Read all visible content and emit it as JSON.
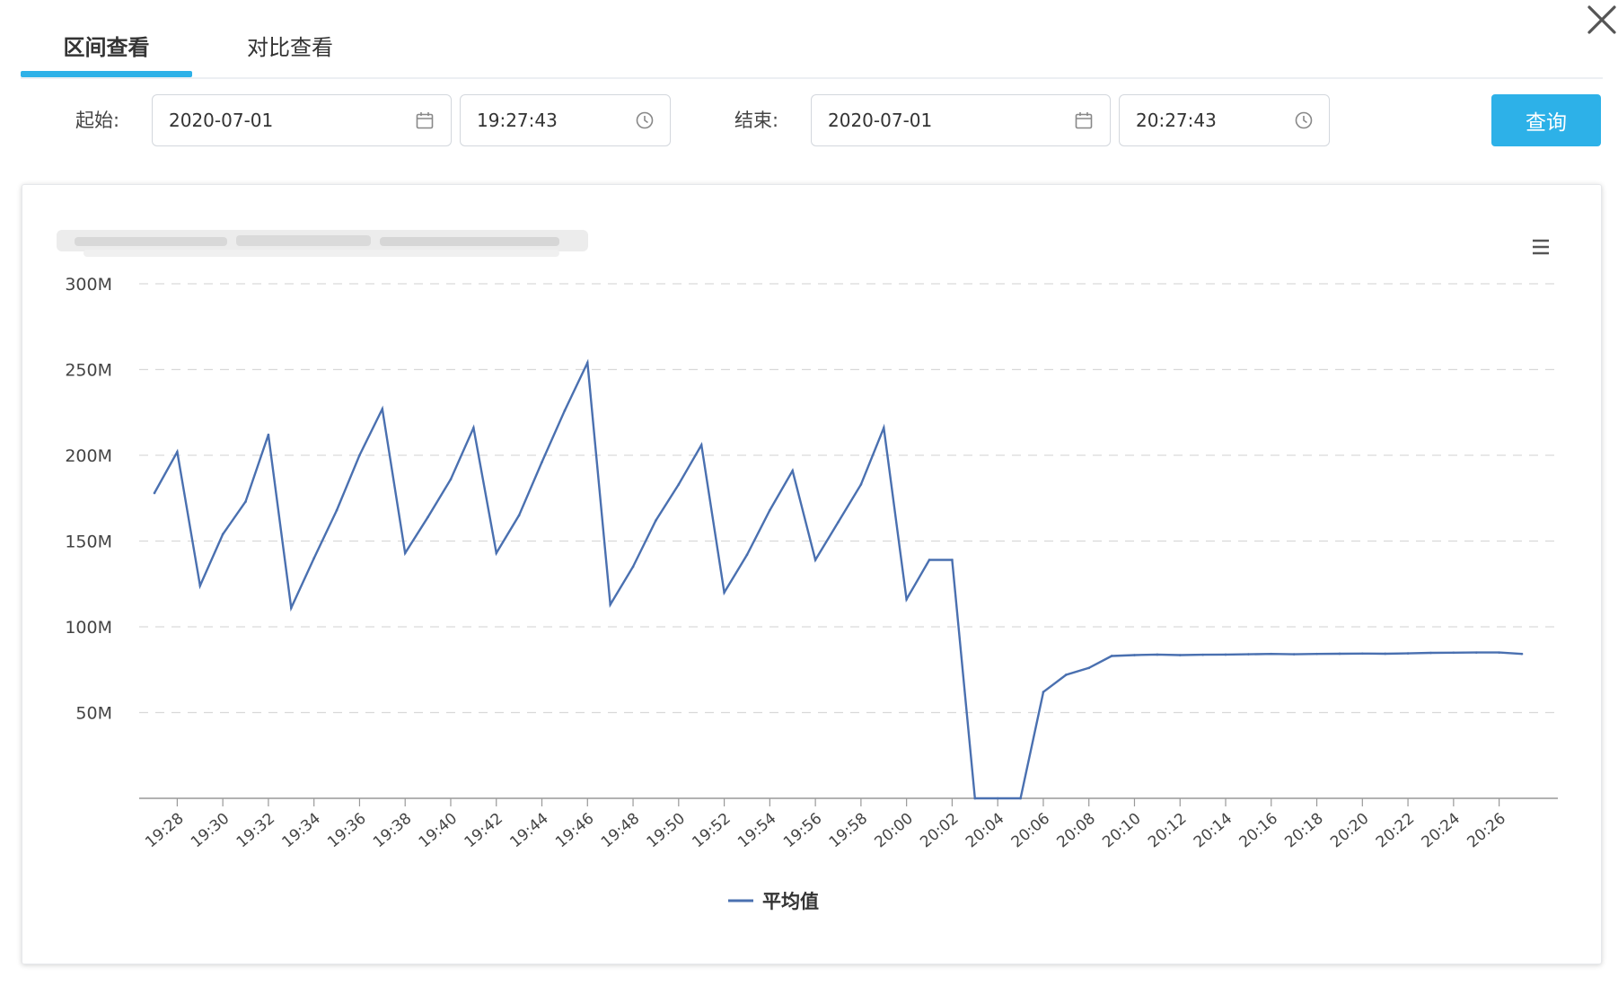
{
  "tabs": [
    {
      "label": "区间查看",
      "active": true
    },
    {
      "label": "对比查看",
      "active": false
    }
  ],
  "filter": {
    "start_label": "起始:",
    "start_date": "2020-07-01",
    "start_time": "19:27:43",
    "end_label": "结束:",
    "end_date": "2020-07-01",
    "end_time": "20:27:43",
    "query_label": "查询"
  },
  "icons": {
    "close": "close-icon",
    "date": "calendar-icon",
    "time": "clock-icon",
    "menu": "hamburger-menu-icon"
  },
  "colors": {
    "accent": "#2db1e8",
    "series": "#4a70b0",
    "grid": "#d9d9d9"
  },
  "chart_data": {
    "type": "line",
    "title": "",
    "title_blurred": true,
    "ylim": [
      0,
      300
    ],
    "y_ticks": [
      {
        "value": 50,
        "label": "50M"
      },
      {
        "value": 100,
        "label": "100M"
      },
      {
        "value": 150,
        "label": "150M"
      },
      {
        "value": 200,
        "label": "200M"
      },
      {
        "value": 250,
        "label": "250M"
      },
      {
        "value": 300,
        "label": "300M"
      }
    ],
    "x": [
      "19:27",
      "19:28",
      "19:29",
      "19:30",
      "19:31",
      "19:32",
      "19:33",
      "19:34",
      "19:35",
      "19:36",
      "19:37",
      "19:38",
      "19:39",
      "19:40",
      "19:41",
      "19:42",
      "19:43",
      "19:44",
      "19:45",
      "19:46",
      "19:47",
      "19:48",
      "19:49",
      "19:50",
      "19:51",
      "19:52",
      "19:53",
      "19:54",
      "19:55",
      "19:56",
      "19:57",
      "19:58",
      "19:59",
      "20:00",
      "20:01",
      "20:02",
      "20:03",
      "20:04",
      "20:05",
      "20:06",
      "20:07",
      "20:08",
      "20:09",
      "20:10",
      "20:11",
      "20:12",
      "20:13",
      "20:14",
      "20:15",
      "20:16",
      "20:17",
      "20:18",
      "20:19",
      "20:20",
      "20:21",
      "20:22",
      "20:23",
      "20:24",
      "20:25",
      "20:26",
      "20:27"
    ],
    "x_tick_labels": [
      "19:28",
      "19:30",
      "19:32",
      "19:34",
      "19:36",
      "19:38",
      "19:40",
      "19:42",
      "19:44",
      "19:46",
      "19:48",
      "19:50",
      "19:52",
      "19:54",
      "19:56",
      "19:58",
      "20:00",
      "20:02",
      "20:04",
      "20:06",
      "20:08",
      "20:10",
      "20:12",
      "20:14",
      "20:16",
      "20:18",
      "20:20",
      "20:22",
      "20:24",
      "20:26"
    ],
    "grid": true,
    "legend": "bottom-center",
    "series": [
      {
        "name": "平均值",
        "values": [
          178,
          202,
          124,
          154,
          173,
          212,
          111,
          140,
          168,
          200,
          227,
          143,
          164,
          186,
          216,
          143,
          165,
          196,
          226,
          254,
          113,
          135,
          162,
          183,
          206,
          120,
          142,
          168,
          191,
          139,
          161,
          183,
          216,
          116,
          139,
          139,
          0,
          0,
          0,
          62,
          72,
          76,
          83,
          83.5,
          83.8,
          83.5,
          83.7,
          83.8,
          84,
          84.2,
          84,
          84.2,
          84.3,
          84.4,
          84.3,
          84.5,
          84.8,
          84.9,
          85,
          85,
          84.2
        ]
      }
    ]
  }
}
